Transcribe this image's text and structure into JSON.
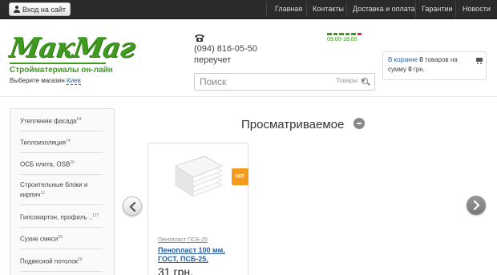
{
  "topbar": {
    "login_label": "Вход на сайт",
    "nav": [
      "Главная",
      "Контакты",
      "Доставка и оплата",
      "Гарантии",
      "Новости"
    ]
  },
  "header": {
    "logo_text": "МакМаг",
    "tagline": "Стройматериалы он-лайн",
    "store_label": "Выберите магазин",
    "store_city": "Киев",
    "phone": "(094) 816-05-50",
    "phone_note": "переучет",
    "hours": "09:00-18:00"
  },
  "search": {
    "placeholder": "Поиск",
    "category": "Товары"
  },
  "cart": {
    "prefix": "В корзине",
    "count": "0",
    "goods_word": "товаров на",
    "sum_prefix": "сумму",
    "sum": "0",
    "currency": "грн."
  },
  "sidebar": {
    "items": [
      {
        "label": "Утепление фасада",
        "count": "64"
      },
      {
        "label": "Теплоизоляция",
        "count": "74"
      },
      {
        "label": "ОСБ плита, OSB",
        "count": "26"
      },
      {
        "label": "Строительные блоки и кирпич",
        "count": "12"
      },
      {
        "label": "Гипсокартон, профиль ..",
        "count": "117"
      },
      {
        "label": "Сухие смеси",
        "count": "59"
      },
      {
        "label": "Подвесной потолок",
        "count": "29"
      }
    ]
  },
  "recently_viewed": {
    "title": "Просматриваемое",
    "products": [
      {
        "badge": "HIT",
        "category": "Пенопласт ПСБ-25",
        "name": "Пенопласт 100 мм, ГОСТ, ПСБ-25,",
        "price": "31 грн."
      }
    ]
  },
  "colors": {
    "brand_green": "#3f9b1f",
    "topbar_bg": "#2b2b2b",
    "link_blue": "#2a5d9f",
    "hit_orange": "#f39a1e"
  }
}
